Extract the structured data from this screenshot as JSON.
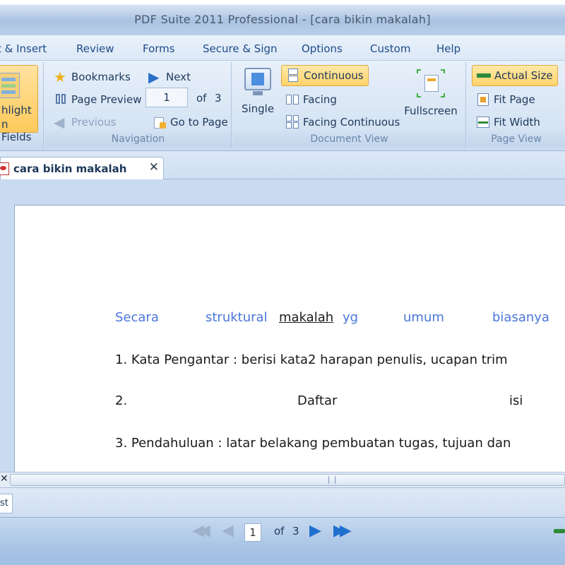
{
  "window": {
    "title": "PDF Suite 2011 Professional - [cara bikin makalah]"
  },
  "menu": [
    "t & Insert",
    "Review",
    "Forms",
    "Secure & Sign",
    "Options",
    "Custom",
    "Help"
  ],
  "ribbon": {
    "highlight": {
      "line1": "hlight",
      "line2": "n Fields"
    },
    "navigation": {
      "label": "Navigation",
      "bookmarks": "Bookmarks",
      "page_preview": "Page Preview",
      "previous": "Previous",
      "next": "Next",
      "page_value": "1",
      "of_label": "of",
      "total_pages": "3",
      "go_to_page": "Go to Page"
    },
    "document_view": {
      "label": "Document View",
      "single": "Single",
      "continuous": "Continuous",
      "facing": "Facing",
      "facing_continuous": "Facing Continuous",
      "fullscreen": "Fullscreen"
    },
    "page_view": {
      "label": "Page View",
      "actual_size": "Actual Size",
      "fit_page": "Fit Page",
      "fit_width": "Fit Width"
    }
  },
  "tab": {
    "name": "cara bikin makalah"
  },
  "document": {
    "line1": {
      "w1": "Secara",
      "w2": "struktural",
      "w3": "makalah",
      "w4": "yg",
      "w5": "umum",
      "w6": "biasanya"
    },
    "line2": "1. Kata Pengantar : berisi kata2 harapan penulis, ucapan trim",
    "line3": {
      "num": "2.",
      "w1": "Daftar",
      "w2": "isi"
    },
    "line4": "3. Pendahuluan : latar belakang pembuatan tugas, tujuan dan"
  },
  "bottom_panel": {
    "tab_label": "st"
  },
  "status": {
    "page_value": "1",
    "of_label": "of",
    "total_pages": "3"
  },
  "colors": {
    "accent": "#ffd36a",
    "link_blue": "#4a76d8",
    "ribbon_bg": "#d5e3f3"
  }
}
